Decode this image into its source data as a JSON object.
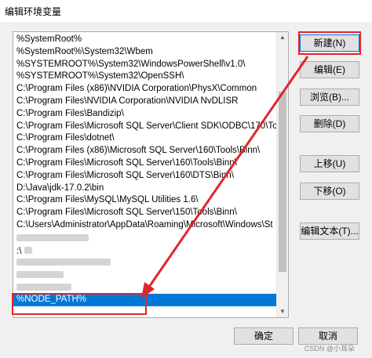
{
  "window": {
    "title": "编辑环境变量"
  },
  "list": {
    "items": [
      "%SystemRoot%",
      "%SystemRoot%\\System32\\Wbem",
      "%SYSTEMROOT%\\System32\\WindowsPowerShell\\v1.0\\",
      "%SYSTEMROOT%\\System32\\OpenSSH\\",
      "C:\\Program Files (x86)\\NVIDIA Corporation\\PhysX\\Common",
      "C:\\Program Files\\NVIDIA Corporation\\NVIDIA NvDLISR",
      "C:\\Program Files\\Bandizip\\",
      "C:\\Program Files\\Microsoft SQL Server\\Client SDK\\ODBC\\170\\Too",
      "C:\\Program Files\\dotnet\\",
      "C:\\Program Files (x86)\\Microsoft SQL Server\\160\\Tools\\Binn\\",
      "C:\\Program Files\\Microsoft SQL Server\\160\\Tools\\Binn\\",
      "C:\\Program Files\\Microsoft SQL Server\\160\\DTS\\Binn\\",
      "D:\\Java\\jdk-17.0.2\\bin",
      "C:\\Program Files\\MySQL\\MySQL Utilities 1.6\\",
      "C:\\Program Files\\Microsoft SQL Server\\150\\Tools\\Binn\\",
      "C:\\Users\\Administrator\\AppData\\Roaming\\Microsoft\\Windows\\St",
      "",
      ":\\",
      "",
      "",
      "",
      "%NODE_PATH%"
    ],
    "selected_index": 21
  },
  "buttons": {
    "new": "新建(N)",
    "edit": "编辑(E)",
    "browse": "浏览(B)...",
    "delete": "删除(D)",
    "move_up": "上移(U)",
    "move_down": "下移(O)",
    "edit_text": "编辑文本(T)..."
  },
  "footer": {
    "ok": "确定",
    "cancel": "取消"
  },
  "watermark": "CSDN @小耳朵",
  "colors": {
    "selection": "#0078d7",
    "annotation": "#e0262b"
  }
}
